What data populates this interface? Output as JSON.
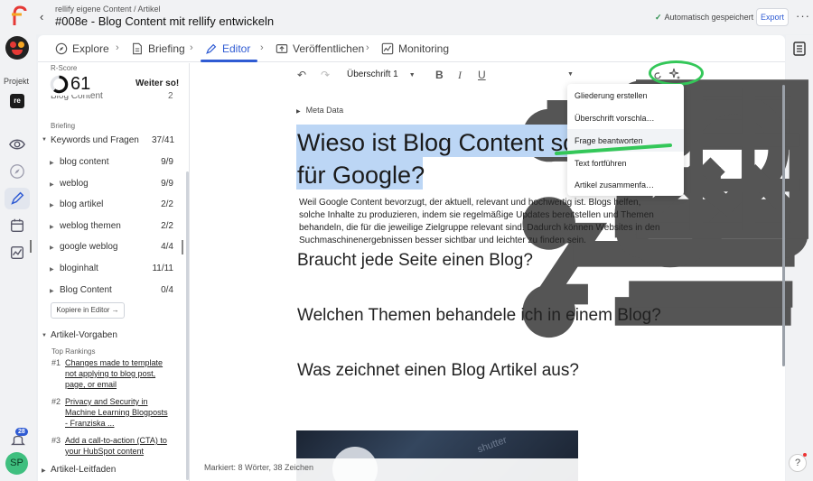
{
  "header": {
    "breadcrumb": "rellify eigene Content / Artikel",
    "title": "#008e - Blog Content mit rellify entwickeln",
    "autosave": "Automatisch gespeichert",
    "export": "Export"
  },
  "rail": {
    "project_label": "Projekt",
    "project_badge": "re",
    "notif_count": "28",
    "user_initials": "SP"
  },
  "tabs": [
    {
      "label": "Explore",
      "icon": "compass-icon"
    },
    {
      "label": "Briefing",
      "icon": "document-icon"
    },
    {
      "label": "Editor",
      "icon": "pen-icon",
      "active": true
    },
    {
      "label": "Veröffentlichen",
      "icon": "publish-icon"
    },
    {
      "label": "Monitoring",
      "icon": "chart-icon"
    }
  ],
  "sidebar": {
    "rscore_label": "R-Score",
    "rscore_value": "61",
    "rscore_action": "Weiter so!",
    "hidden_row": "Blog Content",
    "hidden_row_count": "2",
    "briefing_label": "Briefing",
    "kw_group": "Keywords und Fragen",
    "kw_group_count": "37/41",
    "keywords": [
      {
        "label": "blog content",
        "count": "9/9"
      },
      {
        "label": "weblog",
        "count": "9/9"
      },
      {
        "label": "blog artikel",
        "count": "2/2"
      },
      {
        "label": "weblog themen",
        "count": "2/2"
      },
      {
        "label": "google weblog",
        "count": "4/4"
      },
      {
        "label": "bloginhalt",
        "count": "11/11"
      },
      {
        "label": "Blog Content",
        "count": "0/4"
      }
    ],
    "copy_button": "Kopiere in Editor →",
    "article_specs": "Artikel-Vorgaben",
    "top_rankings": "Top Rankings",
    "rankings": [
      {
        "num": "#1",
        "line1": "Changes made to template",
        "line2": "not applying to blog post,",
        "line3": "page, or email"
      },
      {
        "num": "#2",
        "line1": "Privacy and Security in",
        "line2": "Machine Learning Blogposts",
        "line3": "- Franziska ..."
      },
      {
        "num": "#3",
        "line1": "Add a call-to-action (CTA) to",
        "line2": "your HubSpot content",
        "line3": ""
      }
    ],
    "guideline": "Artikel-Leitfaden"
  },
  "toolbar": {
    "heading_select": "Überschrift 1"
  },
  "editor": {
    "meta": "Meta Data",
    "h1_line1": "Wieso ist Blog Content so",
    "h1_line2": "für Google?",
    "paragraph": "Weil Google Content bevorzugt, der aktuell, relevant und hochwertig ist. Blogs helfen, solche Inhalte zu produzieren, indem sie regelmäßige Updates bereitstellen und Themen behandeln, die für die jeweilige Zielgruppe relevant sind. Dadurch können Websites in den Suchmaschinenergebnissen besser sichtbar und leichter zu finden sein.",
    "h2": [
      "Braucht jede Seite einen Blog?",
      "Welchen Themen behandele ich in einem Blog?",
      "Was zeichnet einen Blog Artikel aus?"
    ],
    "image_watermark": "shutter",
    "status": "Markiert: 8 Wörter, 38 Zeichen"
  },
  "ai_menu": {
    "items": [
      "Gliederung erstellen",
      "Überschrift vorschla…",
      "Frage beantworten",
      "Text fortführen",
      "Artikel zusammenfa…"
    ],
    "highlighted": "Frage beantworten"
  },
  "colors": {
    "accent": "#2f5bd3",
    "annotation": "#34c759",
    "selection": "#bcd6f5"
  }
}
